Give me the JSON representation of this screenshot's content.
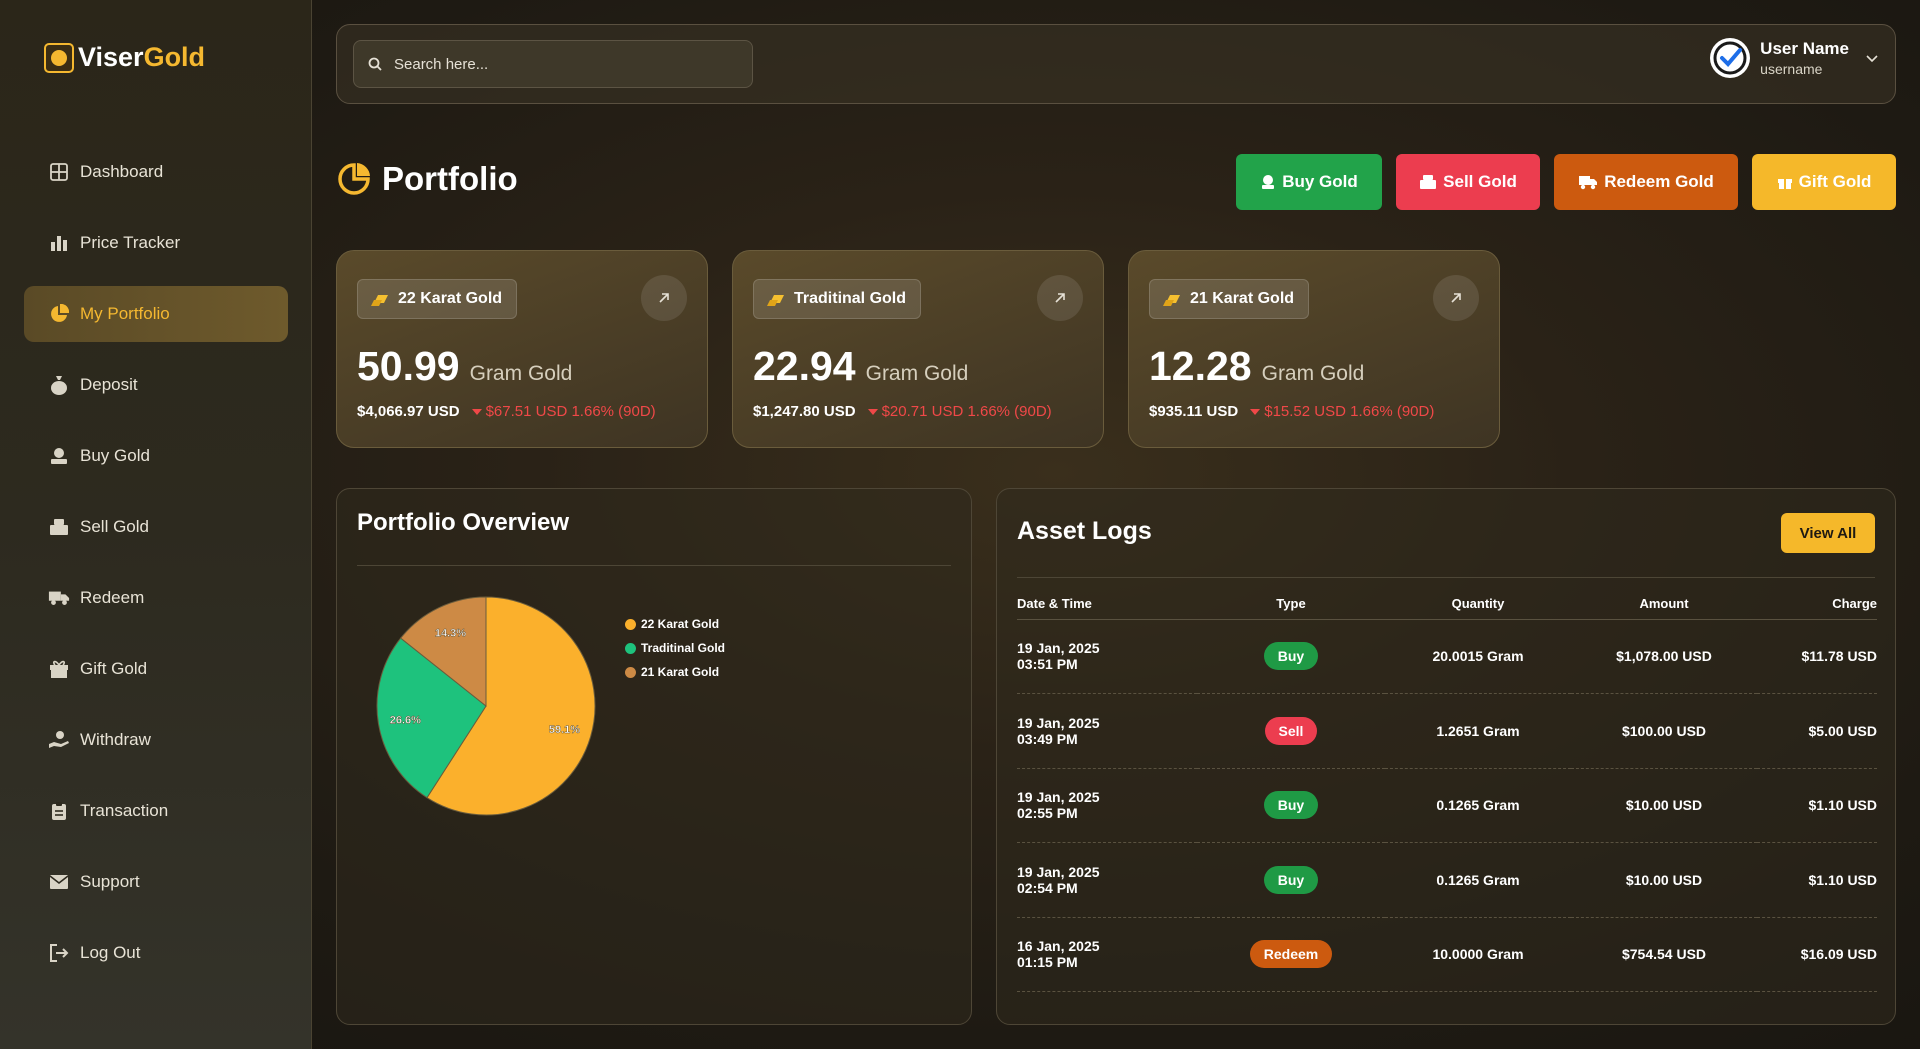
{
  "brand": {
    "first": "Viser",
    "second": "Gold"
  },
  "sidebar": {
    "items": [
      {
        "label": "Dashboard",
        "icon": "dashboard-icon",
        "active": false
      },
      {
        "label": "Price Tracker",
        "icon": "bar-chart-icon",
        "active": false
      },
      {
        "label": "My Portfolio",
        "icon": "pie-chart-icon",
        "active": true
      },
      {
        "label": "Deposit",
        "icon": "money-bag-icon",
        "active": false
      },
      {
        "label": "Buy Gold",
        "icon": "buy-gold-icon",
        "active": false
      },
      {
        "label": "Sell Gold",
        "icon": "sell-gold-icon",
        "active": false
      },
      {
        "label": "Redeem",
        "icon": "truck-icon",
        "active": false
      },
      {
        "label": "Gift Gold",
        "icon": "gift-icon",
        "active": false
      },
      {
        "label": "Withdraw",
        "icon": "withdraw-icon",
        "active": false
      },
      {
        "label": "Transaction",
        "icon": "clipboard-icon",
        "active": false
      },
      {
        "label": "Support",
        "icon": "envelope-icon",
        "active": false
      },
      {
        "label": "Log Out",
        "icon": "logout-icon",
        "active": false
      }
    ]
  },
  "search": {
    "placeholder": "Search here..."
  },
  "user": {
    "name": "User Name",
    "username": "username"
  },
  "page": {
    "title": "Portfolio"
  },
  "actions": {
    "buy": "Buy Gold",
    "sell": "Sell Gold",
    "redeem": "Redeem Gold",
    "gift": "Gift Gold"
  },
  "cards": [
    {
      "label": "22 Karat Gold",
      "amount": "50.99",
      "unit": "Gram Gold",
      "usd": "$4,066.97 USD",
      "change": "$67.51 USD 1.66% (90D)"
    },
    {
      "label": "Traditinal Gold",
      "amount": "22.94",
      "unit": "Gram Gold",
      "usd": "$1,247.80 USD",
      "change": "$20.71 USD 1.66% (90D)"
    },
    {
      "label": "21 Karat Gold",
      "amount": "12.28",
      "unit": "Gram Gold",
      "usd": "$935.11 USD",
      "change": "$15.52 USD 1.66% (90D)"
    }
  ],
  "overview": {
    "title": "Portfolio Overview"
  },
  "chart_data": {
    "type": "pie",
    "categories": [
      "22 Karat Gold",
      "Traditinal Gold",
      "21 Karat Gold"
    ],
    "values": [
      59.1,
      26.6,
      14.3
    ],
    "labels": [
      "59.1%",
      "26.6%",
      "14.3%"
    ],
    "colors": [
      "#fbb02c",
      "#1ec27d",
      "#cd8a45"
    ],
    "legend": "right"
  },
  "logs": {
    "title": "Asset Logs",
    "view_all": "View All",
    "columns": [
      "Date & Time",
      "Type",
      "Quantity",
      "Amount",
      "Charge"
    ],
    "rows": [
      {
        "date": "19 Jan, 2025",
        "time": "03:51 PM",
        "type": "Buy",
        "kind": "buy",
        "qty": "20.0015 Gram",
        "amount": "$1,078.00 USD",
        "charge": "$11.78 USD"
      },
      {
        "date": "19 Jan, 2025",
        "time": "03:49 PM",
        "type": "Sell",
        "kind": "sell",
        "qty": "1.2651 Gram",
        "amount": "$100.00 USD",
        "charge": "$5.00 USD"
      },
      {
        "date": "19 Jan, 2025",
        "time": "02:55 PM",
        "type": "Buy",
        "kind": "buy",
        "qty": "0.1265 Gram",
        "amount": "$10.00 USD",
        "charge": "$1.10 USD"
      },
      {
        "date": "19 Jan, 2025",
        "time": "02:54 PM",
        "type": "Buy",
        "kind": "buy",
        "qty": "0.1265 Gram",
        "amount": "$10.00 USD",
        "charge": "$1.10 USD"
      },
      {
        "date": "16 Jan, 2025",
        "time": "01:15 PM",
        "type": "Redeem",
        "kind": "redeem",
        "qty": "10.0000 Gram",
        "amount": "$754.54 USD",
        "charge": "$16.09 USD"
      }
    ]
  }
}
